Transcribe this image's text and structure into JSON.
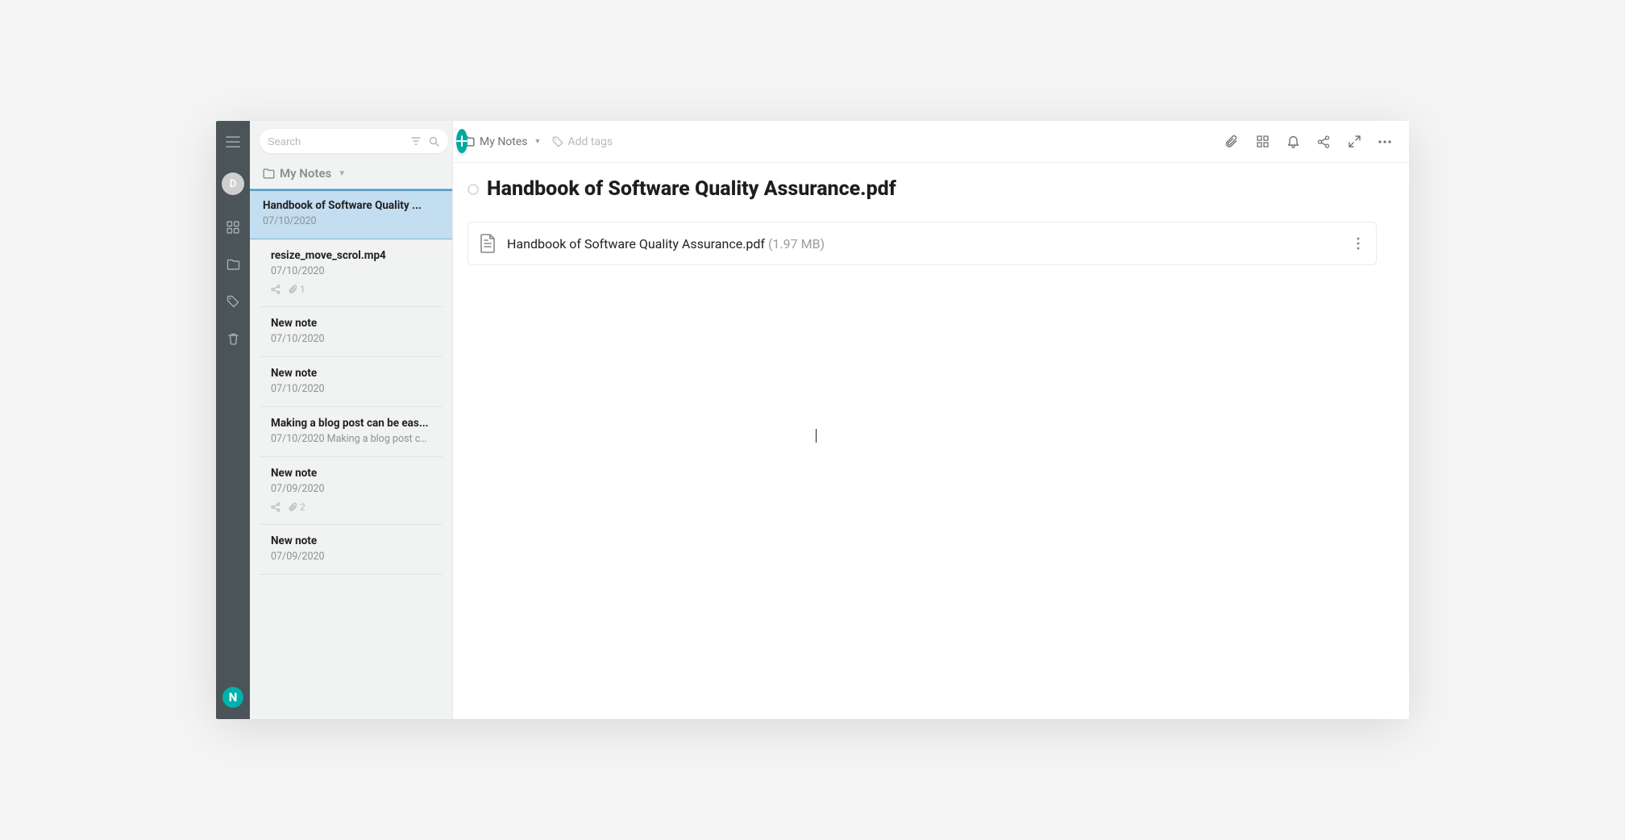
{
  "rail": {
    "avatar_initial": "D"
  },
  "sidebar": {
    "search_placeholder": "Search",
    "folder_label": "My Notes",
    "notes": [
      {
        "title": "Handbook of Software Quality ...",
        "date": "07/10/2020",
        "selected": true
      },
      {
        "title": "resize_move_scrol.mp4",
        "date": "07/10/2020",
        "shared": true,
        "attachments": "1"
      },
      {
        "title": "New note",
        "date": "07/10/2020"
      },
      {
        "title": "New note",
        "date": "07/10/2020"
      },
      {
        "title": "Making a blog post can be eas...",
        "date": "07/10/2020",
        "preview": "Making a blog post ca..."
      },
      {
        "title": "New note",
        "date": "07/09/2020",
        "shared": true,
        "attachments": "2"
      },
      {
        "title": "New note",
        "date": "07/09/2020"
      }
    ]
  },
  "topbar": {
    "breadcrumb": "My Notes",
    "add_tags": "Add tags"
  },
  "note": {
    "title": "Handbook of Software Quality Assurance.pdf",
    "attachment_name": "Handbook of Software Quality Assurance.pdf",
    "attachment_size": "(1.97 MB)"
  }
}
